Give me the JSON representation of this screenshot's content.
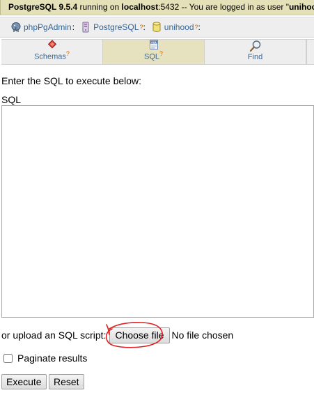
{
  "topbar": {
    "product": "PostgreSQL 9.5.4",
    "running_on": " running on ",
    "host": "localhost",
    "port_text": ":5432 -- You are logged in as user \"",
    "user": "unihood",
    "end_quote": "\""
  },
  "breadcrumb": {
    "items": [
      {
        "label": "phpPgAdmin",
        "help": "",
        "sep": ":",
        "icon": "elephant-icon"
      },
      {
        "label": "PostgreSQL",
        "help": "?",
        "sep": ":",
        "icon": "server-icon"
      },
      {
        "label": "unihood",
        "help": "?",
        "sep": ":",
        "icon": "database-icon"
      }
    ]
  },
  "tabs": [
    {
      "label": "Schemas",
      "help": "?",
      "icon": "schemas-icon",
      "active": false
    },
    {
      "label": "SQL",
      "help": "?",
      "icon": "sql-icon",
      "active": true
    },
    {
      "label": "Find",
      "help": "",
      "icon": "magnifier-icon",
      "active": false
    }
  ],
  "sql_tab_icon_text": "SQL",
  "form": {
    "intro": "Enter the SQL to execute below:",
    "sql_label": "SQL",
    "sql_value": "",
    "upload_label": "or upload an SQL script:",
    "choose_file_label": "Choose file",
    "no_file_text": "No file chosen",
    "paginate_label": "Paginate results",
    "paginate_checked": false,
    "execute_label": "Execute",
    "reset_label": "Reset"
  },
  "colors": {
    "topbar_bg": "#e4e0b8",
    "active_tab_bg": "#e6e2bf",
    "link": "#336699",
    "help_mark": "#cc6600",
    "annotation": "#e02020"
  }
}
